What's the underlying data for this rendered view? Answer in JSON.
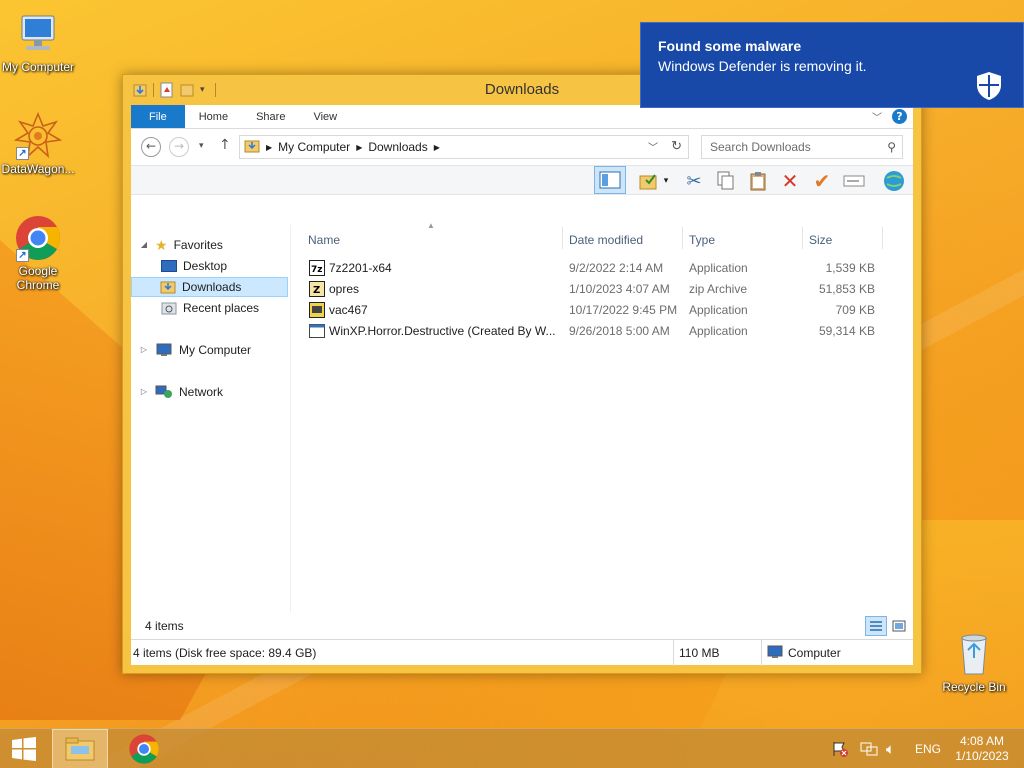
{
  "desktop": {
    "icons": [
      {
        "label": "My Computer",
        "icon": "my-computer-icon"
      },
      {
        "label": "DataWagon...",
        "icon": "datawagon-icon"
      },
      {
        "label": "Google Chrome",
        "icon": "chrome-icon"
      },
      {
        "label": "Recycle Bin",
        "icon": "recycle-bin-icon"
      }
    ]
  },
  "window": {
    "title": "Downloads",
    "ribbon_tabs": [
      "File",
      "Home",
      "Share",
      "View"
    ],
    "address": {
      "crumbs": [
        "My Computer",
        "Downloads"
      ]
    },
    "search": {
      "placeholder": "Search Downloads"
    },
    "nav": {
      "favorites": "Favorites",
      "desktop": "Desktop",
      "downloads": "Downloads",
      "recent": "Recent places",
      "computer": "My Computer",
      "network": "Network"
    },
    "columns": {
      "name": "Name",
      "date": "Date modified",
      "type": "Type",
      "size": "Size"
    },
    "files": [
      {
        "name": "7z2201-x64",
        "date": "9/2/2022 2:14 AM",
        "type": "Application",
        "size": "1,539 KB",
        "icon": "7zip-icon"
      },
      {
        "name": "opres",
        "date": "1/10/2023 4:07 AM",
        "type": "zip Archive",
        "size": "51,853 KB",
        "icon": "zip-archive-icon"
      },
      {
        "name": "vac467",
        "date": "10/17/2022 9:45 PM",
        "type": "Application",
        "size": "709 KB",
        "icon": "installer-icon"
      },
      {
        "name": "WinXP.Horror.Destructive  (Created By W...",
        "date": "9/26/2018 5:00 AM",
        "type": "Application",
        "size": "59,314 KB",
        "icon": "application-icon"
      }
    ],
    "item_count": "4 items",
    "status": {
      "summary": "4 items (Disk free space: 89.4 GB)",
      "size": "110 MB",
      "location": "Computer"
    }
  },
  "notification": {
    "title": "Found some malware",
    "message": "Windows Defender is removing it."
  },
  "taskbar": {
    "language": "ENG",
    "time": "4:08 AM",
    "date": "1/10/2023"
  },
  "colors": {
    "accent": "#1979ca",
    "toast": "#1849a8",
    "window_frame": "#f6c343"
  }
}
